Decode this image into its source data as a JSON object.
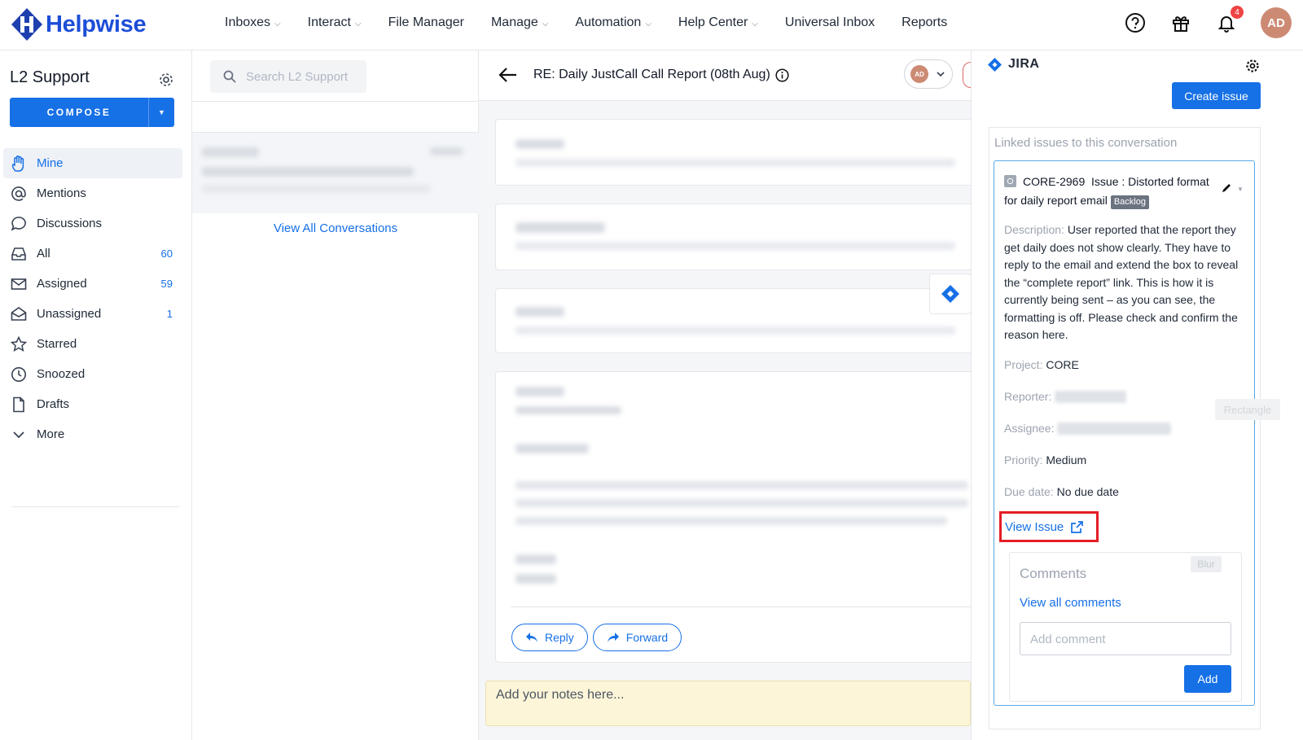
{
  "app": {
    "name": "Helpwise"
  },
  "nav": [
    {
      "label": "Inboxes",
      "has_menu": true
    },
    {
      "label": "Interact",
      "has_menu": true
    },
    {
      "label": "File Manager",
      "has_menu": false
    },
    {
      "label": "Manage",
      "has_menu": true
    },
    {
      "label": "Automation",
      "has_menu": true
    },
    {
      "label": "Help Center",
      "has_menu": true
    },
    {
      "label": "Universal Inbox",
      "has_menu": false
    },
    {
      "label": "Reports",
      "has_menu": false
    }
  ],
  "topbar": {
    "notification_count": "4",
    "user_initials": "AD"
  },
  "sidebar": {
    "title": "L2 Support",
    "compose_label": "COMPOSE",
    "items": [
      {
        "label": "Mine",
        "count": "",
        "icon": "hand-icon",
        "active": true
      },
      {
        "label": "Mentions",
        "count": "",
        "icon": "at-icon"
      },
      {
        "label": "Discussions",
        "count": "",
        "icon": "chat-icon"
      },
      {
        "label": "All",
        "count": "60",
        "icon": "inbox-icon"
      },
      {
        "label": "Assigned",
        "count": "59",
        "icon": "mail-icon"
      },
      {
        "label": "Unassigned",
        "count": "1",
        "icon": "open-mail-icon"
      },
      {
        "label": "Starred",
        "count": "",
        "icon": "star-icon"
      },
      {
        "label": "Snoozed",
        "count": "",
        "icon": "clock-icon"
      },
      {
        "label": "Drafts",
        "count": "",
        "icon": "file-icon"
      },
      {
        "label": "More",
        "count": "",
        "icon": "chevron-down-icon"
      }
    ]
  },
  "conversations": {
    "search_placeholder": "Search L2 Support",
    "view_all_label": "View All Conversations"
  },
  "thread": {
    "subject": "RE: Daily JustCall Call Report (08th Aug)",
    "assignee_initials": "AD",
    "reply_label": "Reply",
    "forward_label": "Forward",
    "notes_placeholder": "Add your notes here..."
  },
  "jira": {
    "title": "JIRA",
    "create_label": "Create issue",
    "linked_title": "Linked issues to this conversation",
    "issue": {
      "key": "CORE-2969",
      "summary": "Issue : Distorted format for daily report email",
      "status": "Backlog",
      "description_label": "Description:",
      "description": "User reported that the report they get daily does not show clearly. They have to reply to the email and extend the box to reveal the “complete report” link. This is how it is currently being sent – as you can see, the formatting is off. Please check and confirm the reason here.",
      "project_label": "Project:",
      "project": "CORE",
      "reporter_label": "Reporter:",
      "assignee_label": "Assignee:",
      "priority_label": "Priority:",
      "priority": "Medium",
      "due_label": "Due date:",
      "due": "No due date",
      "view_label": "View Issue"
    },
    "comments": {
      "title": "Comments",
      "blur_tag": "Blur",
      "view_all": "View all comments",
      "placeholder": "Add comment",
      "add_label": "Add"
    }
  },
  "overlay": {
    "rect_tag": "Rectangle"
  },
  "colors": {
    "accent": "#1670e6",
    "highlight": "#e41e26",
    "notes_bg": "#fdf5d7"
  }
}
